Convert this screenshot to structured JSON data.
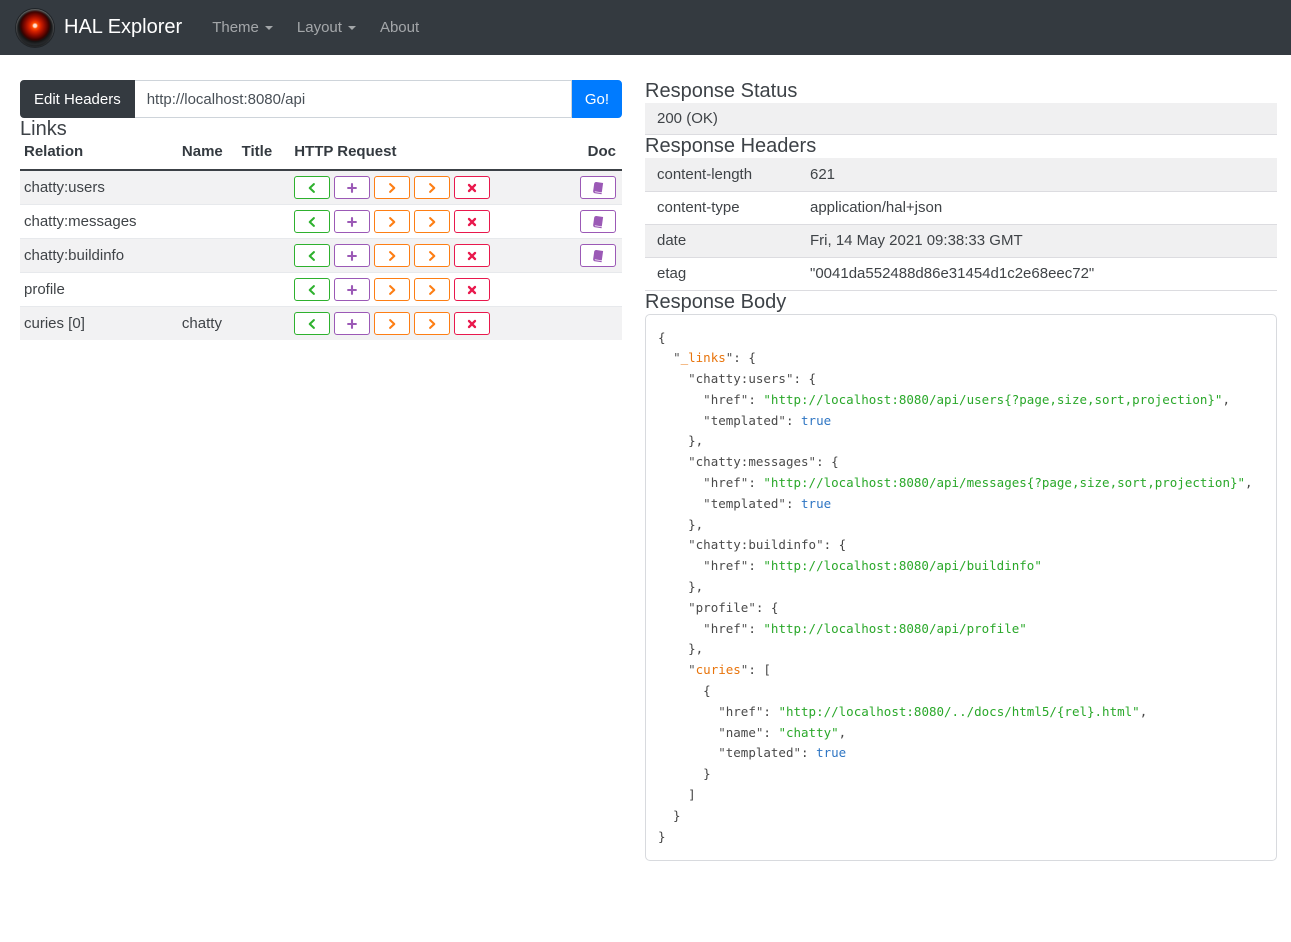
{
  "navbar": {
    "brand": "HAL Explorer",
    "items": [
      {
        "label": "Theme",
        "has_dropdown": true
      },
      {
        "label": "Layout",
        "has_dropdown": true
      },
      {
        "label": "About",
        "has_dropdown": false
      }
    ]
  },
  "request_bar": {
    "edit_headers_label": "Edit Headers",
    "url_value": "http://localhost:8080/api",
    "go_label": "Go!"
  },
  "links_section": {
    "title": "Links",
    "columns": [
      "Relation",
      "Name",
      "Title",
      "HTTP Request",
      "Doc"
    ],
    "request_buttons": [
      {
        "method": "get",
        "icon": "chevron-left-icon"
      },
      {
        "method": "post",
        "icon": "plus-icon"
      },
      {
        "method": "put",
        "icon": "chevron-right-icon"
      },
      {
        "method": "patch",
        "icon": "chevron-right-icon"
      },
      {
        "method": "delete",
        "icon": "x-icon"
      }
    ],
    "doc_button": {
      "icon": "book-icon"
    },
    "rows": [
      {
        "relation": "chatty:users",
        "name": "",
        "title": "",
        "doc": true
      },
      {
        "relation": "chatty:messages",
        "name": "",
        "title": "",
        "doc": true
      },
      {
        "relation": "chatty:buildinfo",
        "name": "",
        "title": "",
        "doc": true
      },
      {
        "relation": "profile",
        "name": "",
        "title": "",
        "doc": false
      },
      {
        "relation": "curies [0]",
        "name": "chatty",
        "title": "",
        "doc": false
      }
    ]
  },
  "response": {
    "status_title": "Response Status",
    "status_value": "200 (OK)",
    "headers_title": "Response Headers",
    "headers": [
      {
        "name": "content-length",
        "value": "621"
      },
      {
        "name": "content-type",
        "value": "application/hal+json"
      },
      {
        "name": "date",
        "value": "Fri, 14 May 2021 09:38:33 GMT"
      },
      {
        "name": "etag",
        "value": "\"0041da552488d86e31454d1c2e68eec72\""
      }
    ],
    "body_title": "Response Body",
    "reserved_keys": [
      "_links",
      "curies"
    ],
    "body_json": "{\n  \"_links\": {\n    \"chatty:users\": {\n      \"href\": \"http://localhost:8080/api/users{?page,size,sort,projection}\",\n      \"templated\": true\n    },\n    \"chatty:messages\": {\n      \"href\": \"http://localhost:8080/api/messages{?page,size,sort,projection}\",\n      \"templated\": true\n    },\n    \"chatty:buildinfo\": {\n      \"href\": \"http://localhost:8080/api/buildinfo\"\n    },\n    \"profile\": {\n      \"href\": \"http://localhost:8080/api/profile\"\n    },\n    \"curies\": [\n      {\n        \"href\": \"http://localhost:8080/../docs/html5/{rel}.html\",\n        \"name\": \"chatty\",\n        \"templated\": true\n      }\n    ]\n  }\n}"
  },
  "colors": {
    "navbar_bg": "#343a40",
    "primary_blue": "#007bff",
    "get_green": "#2eb12e",
    "post_purple": "#9b59b6",
    "put_patch_orange": "#fd7e14",
    "delete_red": "#e9184c",
    "doc_purple": "#9b59b6",
    "json_reserved_key_orange": "#e8740c",
    "json_string_green": "#2aa82a",
    "json_literal_blue": "#2e75c3"
  }
}
